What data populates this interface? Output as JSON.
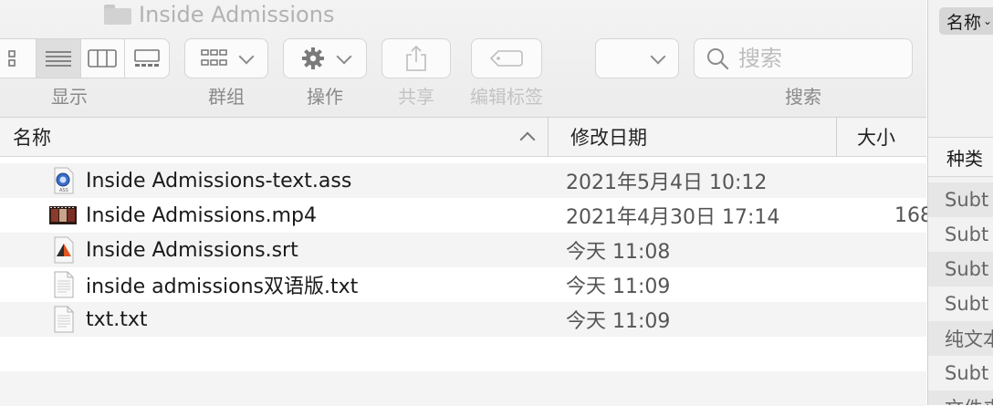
{
  "window": {
    "title": "Inside Admissions"
  },
  "toolbar": {
    "view_label": "显示",
    "group_label": "群组",
    "action_label": "操作",
    "share_label": "共享",
    "tag_label": "编辑标签",
    "search_label": "搜索",
    "search_placeholder": "搜索"
  },
  "columns": {
    "name": "名称",
    "modified": "修改日期",
    "size": "大小"
  },
  "files": [
    {
      "name": "Inside Admissions-text.ass",
      "modified": "2021年5月4日 10:12",
      "size": "",
      "icon": "ass-file-icon"
    },
    {
      "name": "Inside Admissions.mp4",
      "modified": "2021年4月30日 17:14",
      "size": "168",
      "icon": "video-thumbnail-icon"
    },
    {
      "name": "Inside Admissions.srt",
      "modified": "今天 11:08",
      "size": "",
      "icon": "srt-file-icon"
    },
    {
      "name": "inside admissions双语版.txt",
      "modified": "今天 11:09",
      "size": "",
      "icon": "text-file-icon"
    },
    {
      "name": "txt.txt",
      "modified": "今天 11:09",
      "size": "",
      "icon": "text-file-icon"
    }
  ],
  "right_panel": {
    "sort_label": "名称",
    "kind_header": "种类",
    "kinds": [
      "Subt",
      "Subt",
      "Subt",
      "Subt",
      "纯文本",
      "Subt",
      "文件夹"
    ]
  }
}
